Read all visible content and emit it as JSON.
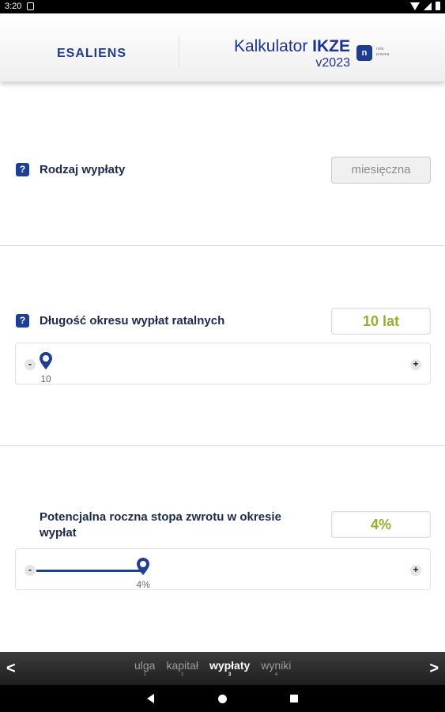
{
  "status_bar": {
    "time": "3:20"
  },
  "header": {
    "logo": "ESALIENS",
    "title_prefix": "Kalkulator ",
    "title_bold": "IKZE",
    "version": "v2023",
    "badge": "n",
    "badge_note": "nola prawna"
  },
  "payout_type": {
    "help": "?",
    "label": "Rodzaj wypłaty",
    "value": "miesięczna"
  },
  "payout_period": {
    "help": "?",
    "label": "Długość okresu wypłat ratalnych",
    "value": "10 lat",
    "slider": {
      "minus": "-",
      "plus": "+",
      "value_label": "10",
      "fraction": 0.0
    }
  },
  "return_rate": {
    "label": "Potencjalna roczna stopa zwrotu w okresie wypłat",
    "value": "4%",
    "slider": {
      "minus": "-",
      "plus": "+",
      "value_label": "4%",
      "fraction": 0.28
    }
  },
  "bottom_nav": {
    "prev": "<",
    "next": ">",
    "steps": [
      {
        "label": "ulga",
        "num": "1"
      },
      {
        "label": "kapitał",
        "num": "2"
      },
      {
        "label": "wypłaty",
        "num": "3",
        "active": true
      },
      {
        "label": "wyniki",
        "num": "4"
      }
    ]
  }
}
